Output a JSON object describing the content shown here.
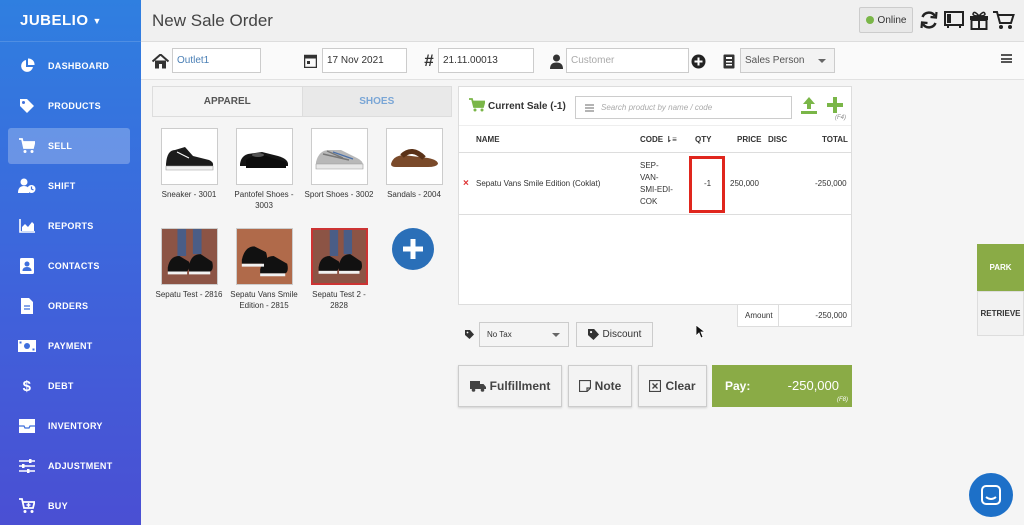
{
  "sidebar": {
    "brand": "JUBELIO",
    "items": [
      {
        "label": "DASHBOARD",
        "icon": "pie-chart-icon"
      },
      {
        "label": "PRODUCTS",
        "icon": "tag-icon"
      },
      {
        "label": "SELL",
        "icon": "cart-icon"
      },
      {
        "label": "SHIFT",
        "icon": "user-clock-icon"
      },
      {
        "label": "REPORTS",
        "icon": "area-chart-icon"
      },
      {
        "label": "CONTACTS",
        "icon": "contact-card-icon"
      },
      {
        "label": "ORDERS",
        "icon": "document-icon"
      },
      {
        "label": "PAYMENT",
        "icon": "money-icon"
      },
      {
        "label": "DEBT",
        "icon": "dollar-icon"
      },
      {
        "label": "INVENTORY",
        "icon": "inbox-icon"
      },
      {
        "label": "ADJUSTMENT",
        "icon": "sliders-icon"
      },
      {
        "label": "BUY",
        "icon": "cart-plus-icon"
      }
    ],
    "active": "SELL"
  },
  "header": {
    "title": "New Sale Order",
    "status": "Online"
  },
  "filters": {
    "outlet": "Outlet1",
    "date": "17 Nov 2021",
    "order_number": "21.11.00013",
    "customer_placeholder": "Customer",
    "sales_person": "Sales Person"
  },
  "categories": [
    {
      "label": "APPAREL",
      "active": false
    },
    {
      "label": "SHOES",
      "active": true
    }
  ],
  "products": [
    {
      "name": "Sneaker - 3001"
    },
    {
      "name": "Pantofel Shoes - 3003"
    },
    {
      "name": "Sport Shoes - 3002"
    },
    {
      "name": "Sandals - 2004"
    },
    {
      "name": "Sepatu Test - 2816"
    },
    {
      "name": "Sepatu Vans Smile Edition - 2815"
    },
    {
      "name": "Sepatu Test 2 - 2828"
    }
  ],
  "cart": {
    "title": "Current Sale (-1)",
    "search_placeholder": "Search product by name / code",
    "shortcut_add": "(F4)",
    "columns": {
      "name": "NAME",
      "code": "CODE",
      "qty": "QTY",
      "price": "PRICE",
      "disc": "DISC",
      "total": "TOTAL"
    },
    "items": [
      {
        "name": "Sepatu Vans Smile Edition (Coklat)",
        "code_lines": [
          "SEP-",
          "VAN-",
          "SMI-EDI-",
          "COK"
        ],
        "qty": "-1",
        "price": "250,000",
        "disc": "",
        "total": "-250,000"
      }
    ],
    "amount_label": "Amount",
    "amount_value": "-250,000"
  },
  "tax": {
    "selected": "No Tax"
  },
  "discount_label": "Discount",
  "actions": {
    "fulfillment": "Fulfillment",
    "note": "Note",
    "clear": "Clear",
    "pay_label": "Pay:",
    "pay_value": "-250,000",
    "pay_shortcut": "(F8)"
  },
  "side_buttons": {
    "park": "PARK",
    "retrieve": "RETRIEVE"
  },
  "colors": {
    "sidebar_top": "#2f7fe0",
    "sidebar_bottom": "#4a4fd3",
    "accent_green": "#8aab46",
    "highlight_red": "#e0261d"
  }
}
